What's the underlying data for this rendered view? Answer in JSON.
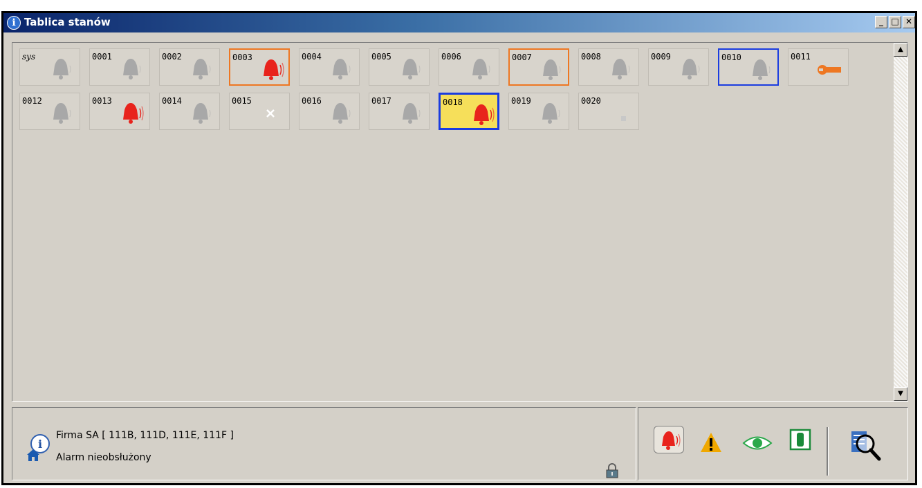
{
  "window": {
    "title": "Tablica stanów",
    "buttons": {
      "minimize": "_",
      "maximize": "□",
      "close": "✕"
    }
  },
  "zones": [
    {
      "label": "sys",
      "state": "idle"
    },
    {
      "label": "0001",
      "state": "idle"
    },
    {
      "label": "0002",
      "state": "idle"
    },
    {
      "label": "0003",
      "state": "alarm",
      "highlight": "orange"
    },
    {
      "label": "0004",
      "state": "idle"
    },
    {
      "label": "0005",
      "state": "idle"
    },
    {
      "label": "0006",
      "state": "idle"
    },
    {
      "label": "0007",
      "state": "idle",
      "highlight": "orange"
    },
    {
      "label": "0008",
      "state": "idle"
    },
    {
      "label": "0009",
      "state": "idle"
    },
    {
      "label": "0010",
      "state": "idle",
      "highlight": "blue"
    },
    {
      "label": "0011",
      "state": "service"
    },
    {
      "label": "0012",
      "state": "idle"
    },
    {
      "label": "0013",
      "state": "alarm"
    },
    {
      "label": "0014",
      "state": "idle"
    },
    {
      "label": "0015",
      "state": "disabled"
    },
    {
      "label": "0016",
      "state": "idle"
    },
    {
      "label": "0017",
      "state": "idle"
    },
    {
      "label": "0018",
      "state": "alarm",
      "highlight": "blue-yellow"
    },
    {
      "label": "0019",
      "state": "idle"
    },
    {
      "label": "0020",
      "state": "none"
    }
  ],
  "info": {
    "client": "Firma SA [ 111B, 111D, 111E, 111F ]",
    "status": "Alarm nieobsłużony",
    "icons": [
      "info-icon",
      "home-icon",
      "padlock-icon"
    ]
  },
  "toolbar": {
    "icons": [
      "alarm-bell-button-icon",
      "warning-icon",
      "eye-icon",
      "green-bar-icon",
      "magnifier-list-icon"
    ]
  },
  "colors": {
    "alarm_red": "#e8231c",
    "bell_gray": "#a8a8a8",
    "highlight_orange": "#ee7722",
    "highlight_blue": "#1a3ce0",
    "highlight_yellow": "#f6df5a",
    "title_blue": "#0a246a"
  }
}
